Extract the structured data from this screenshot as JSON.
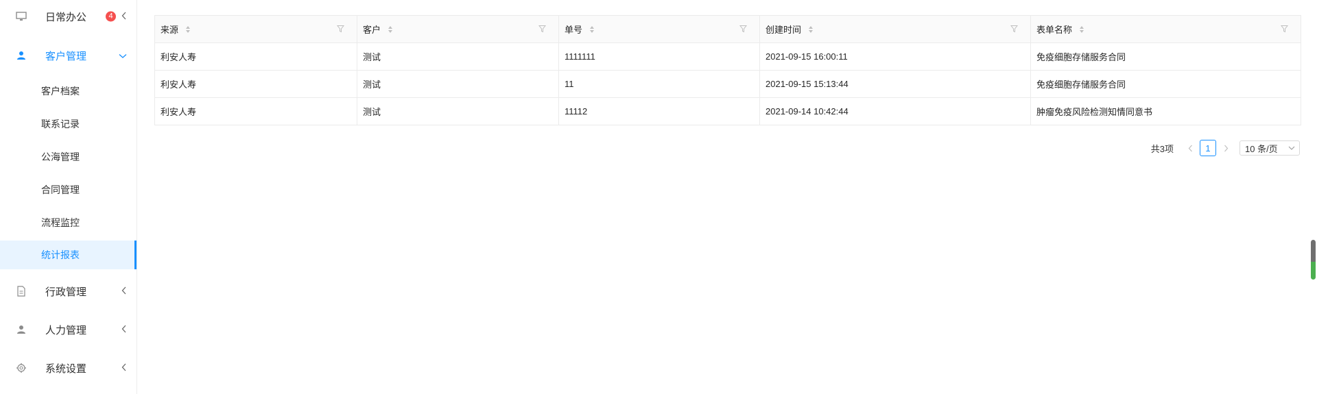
{
  "sidebar": {
    "items": [
      {
        "label": "日常办公",
        "icon": "monitor-icon",
        "badge": "4"
      },
      {
        "label": "客户管理",
        "icon": "user-icon",
        "expanded": true,
        "children": [
          "客户档案",
          "联系记录",
          "公海管理",
          "合同管理",
          "流程监控",
          "统计报表"
        ],
        "active_child": "统计报表"
      },
      {
        "label": "行政管理",
        "icon": "document-icon"
      },
      {
        "label": "人力管理",
        "icon": "person-icon"
      },
      {
        "label": "系统设置",
        "icon": "gear-icon"
      }
    ]
  },
  "table": {
    "columns": [
      "来源",
      "客户",
      "单号",
      "创建时间",
      "表单名称"
    ],
    "rows": [
      [
        "利安人寿",
        "测试",
        "1111111",
        "2021-09-15 16:00:11",
        "免疫细胞存储服务合同"
      ],
      [
        "利安人寿",
        "测试",
        "11",
        "2021-09-15 15:13:44",
        "免疫细胞存储服务合同"
      ],
      [
        "利安人寿",
        "测试",
        "11112",
        "2021-09-14 10:42:44",
        "肿瘤免疫风险检测知情同意书"
      ]
    ]
  },
  "pagination": {
    "total_text": "共3项",
    "current_page": "1",
    "page_size": "10 条/页"
  },
  "colors": {
    "accent": "#1890ff",
    "badge": "#f5504f"
  }
}
